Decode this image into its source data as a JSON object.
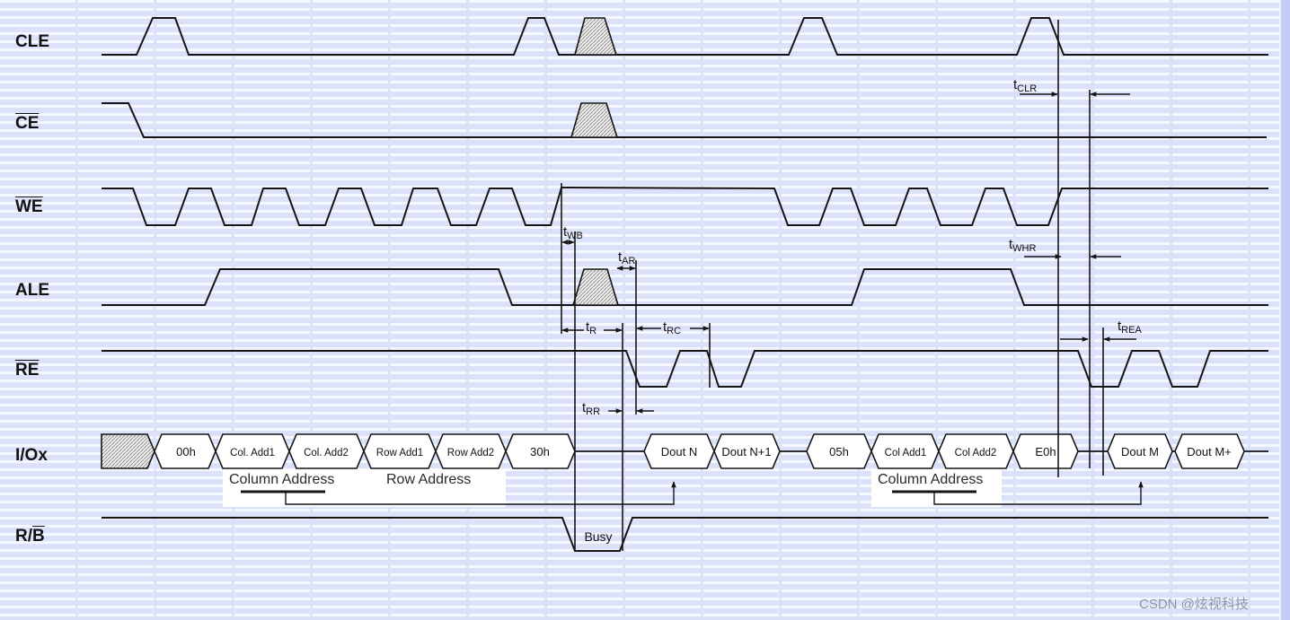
{
  "signals": {
    "cle": "CLE",
    "ce": "CE",
    "we": "WE",
    "ale": "ALE",
    "re": "RE",
    "io": "I/Ox",
    "rb": {
      "text": "R/",
      "overline": "B"
    }
  },
  "io_bus": [
    "00h",
    "Col. Add1",
    "Col. Add2",
    "Row Add1",
    "Row Add2",
    "30h",
    "Dout N",
    "Dout N+1",
    "05h",
    "Col Add1",
    "Col Add2",
    "E0h",
    "Dout M",
    "Dout M+"
  ],
  "address_groups": {
    "group_1": "Column Address",
    "group_2": "Row Address",
    "group_3": "Column Address"
  },
  "timing": {
    "wb": "tWB",
    "ar": "tAR",
    "r": "tR",
    "rc": "tRC",
    "rr": "tRR",
    "clr": "tCLR",
    "whr": "tWHR",
    "rea": "tREA"
  },
  "busy_label": "Busy",
  "watermark": "CSDN @炫视科技",
  "colors": {
    "background": "#dbe1f8",
    "grid_line": "#f6f8ff",
    "waveform": "#151515",
    "hatch": "#8a8a8a",
    "bus_fill": "#ffffff",
    "watermark": "#8e94a8"
  }
}
